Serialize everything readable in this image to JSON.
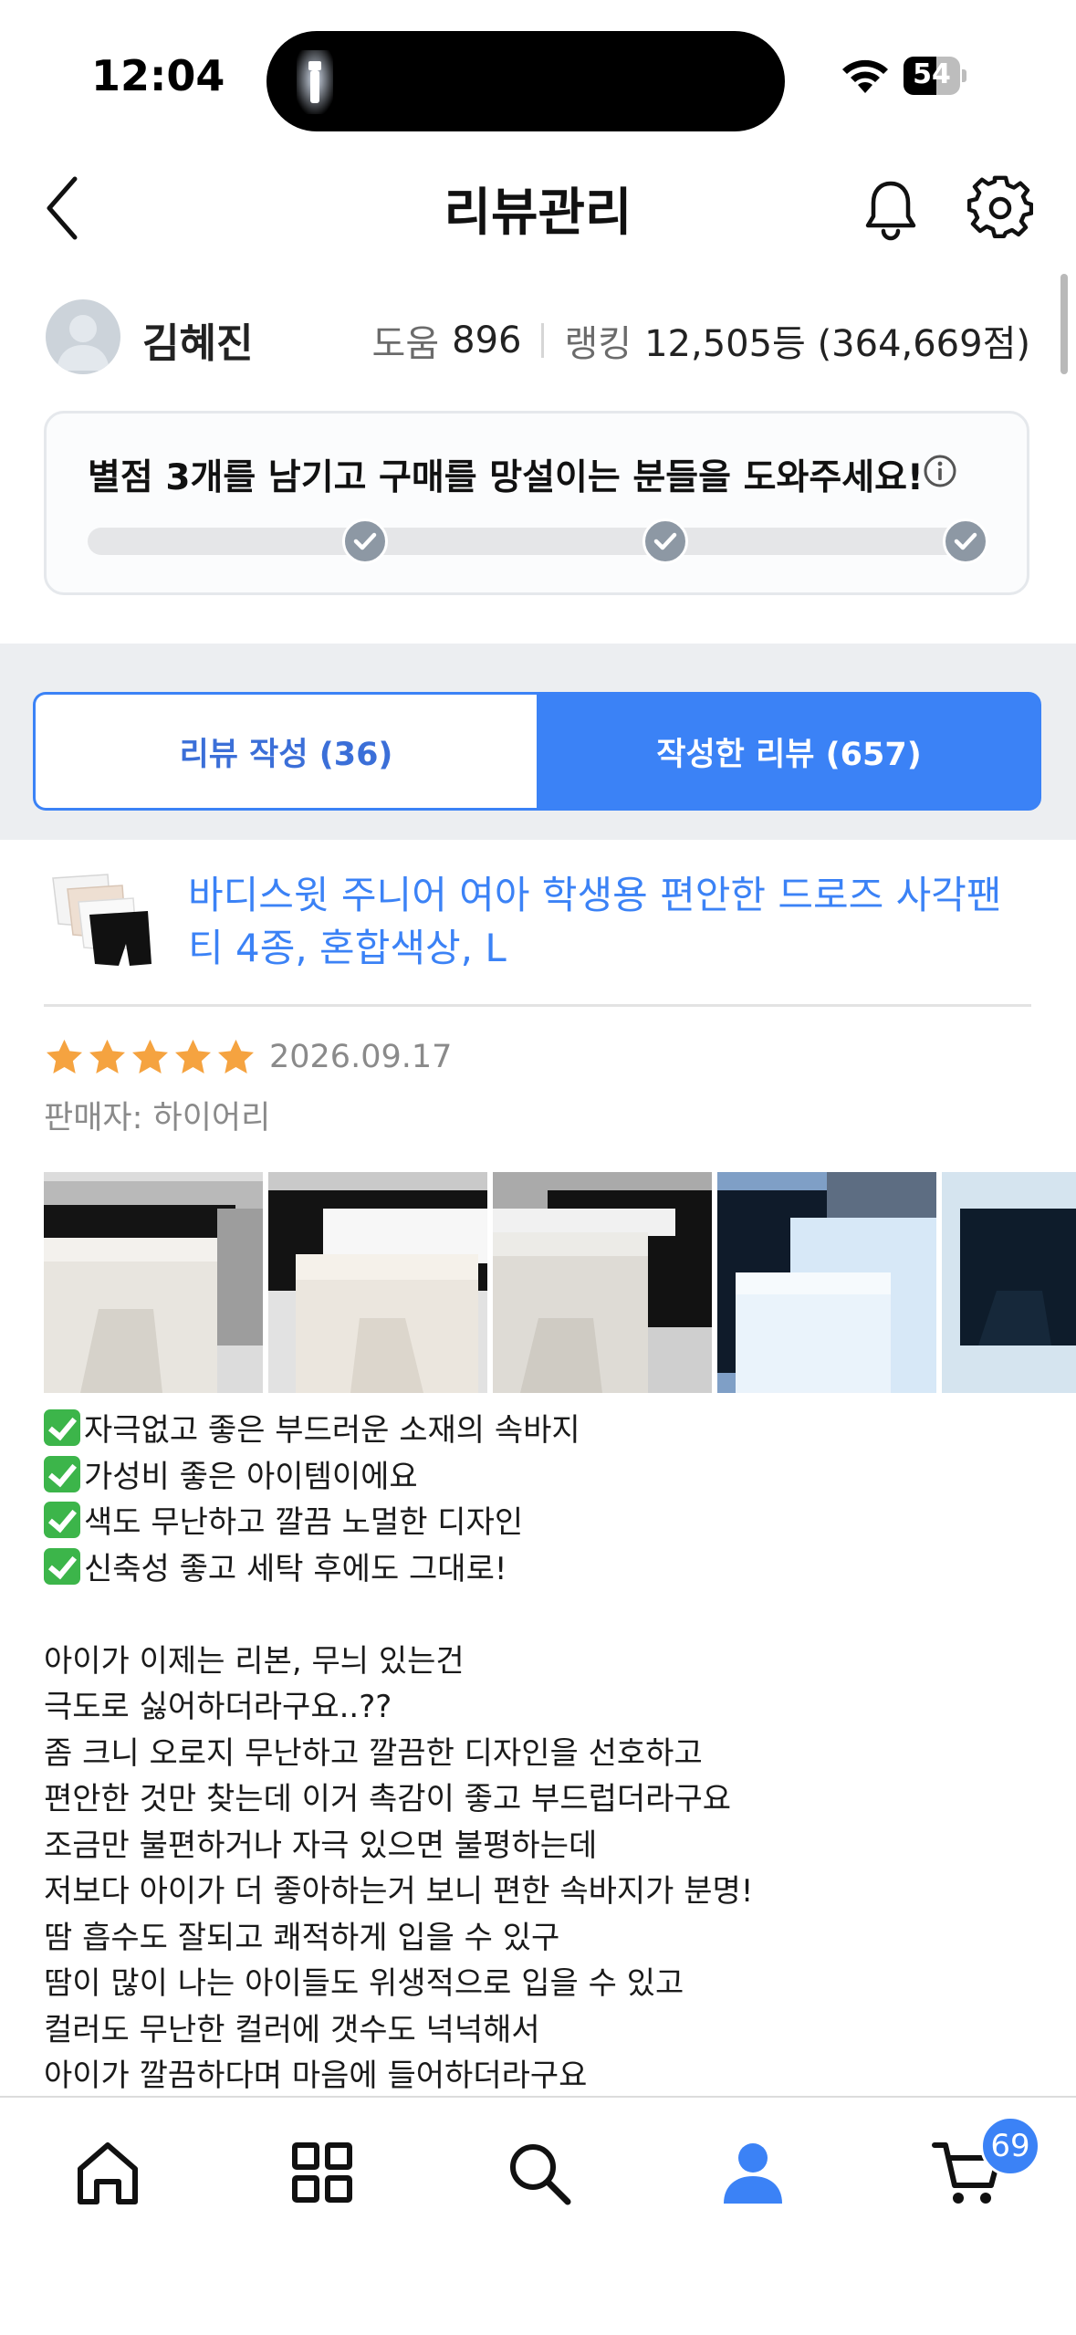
{
  "status_bar": {
    "time": "12:04",
    "battery": "54"
  },
  "header": {
    "title": "리뷰관리"
  },
  "profile": {
    "name": "김혜진",
    "help_label": "도움",
    "help_count": "896",
    "ranking_label": "랭킹",
    "ranking_value": "12,505등 (364,669점)"
  },
  "progress_card": {
    "message": "별점 3개를 남기고 구매를 망설이는 분들을 도와주세요!",
    "steps_completed": 3,
    "steps_total": 3
  },
  "tabs": [
    {
      "label": "리뷰 작성 (36)",
      "active": false
    },
    {
      "label": "작성한 리뷰 (657)",
      "active": true
    }
  ],
  "review": {
    "product_title": "바디스윗 주니어 여아 학생용 편안한 드로즈 사각팬티 4종, 혼합색상, L",
    "rating": 5,
    "date": "2026.09.17",
    "seller": "판매자: 하이어리",
    "highlights": [
      "자극없고 좋은 부드러운 소재의 속바지",
      "가성비 좋은 아이템이에요",
      "색도 무난하고 깔끔 노멀한 디자인",
      "신축성 좋고 세탁 후에도 그대로!"
    ],
    "body_lines": [
      "아이가 이제는 리본, 무늬 있는건",
      "극도로 싫어하더라구요..??",
      "좀 크니 오로지 무난하고 깔끔한 디자인을 선호하고",
      "편안한 것만 찾는데 이거 촉감이 좋고 부드럽더라구요",
      "조금만 불편하거나 자극 있으면 불평하는데",
      "저보다 아이가 더 좋아하는거 보니 편한 속바지가 분명!",
      "땀 흡수도 잘되고 쾌적하게 입을 수 있구",
      "땀이 많이 나는 아이들도 위생적으로 입을 수 있고",
      "컬러도 무난한 컬러에 갯수도 넉넉해서",
      "아이가 깔끔하다며 마음에 들어하더라구요"
    ]
  },
  "bottom_nav": {
    "items": [
      "home-icon",
      "category-icon",
      "search-icon",
      "my-icon",
      "cart-icon"
    ],
    "cart_badge": "69"
  },
  "colors": {
    "accent": "#3b82f6",
    "star": "#f5a340",
    "check_green": "#3cb54a"
  }
}
